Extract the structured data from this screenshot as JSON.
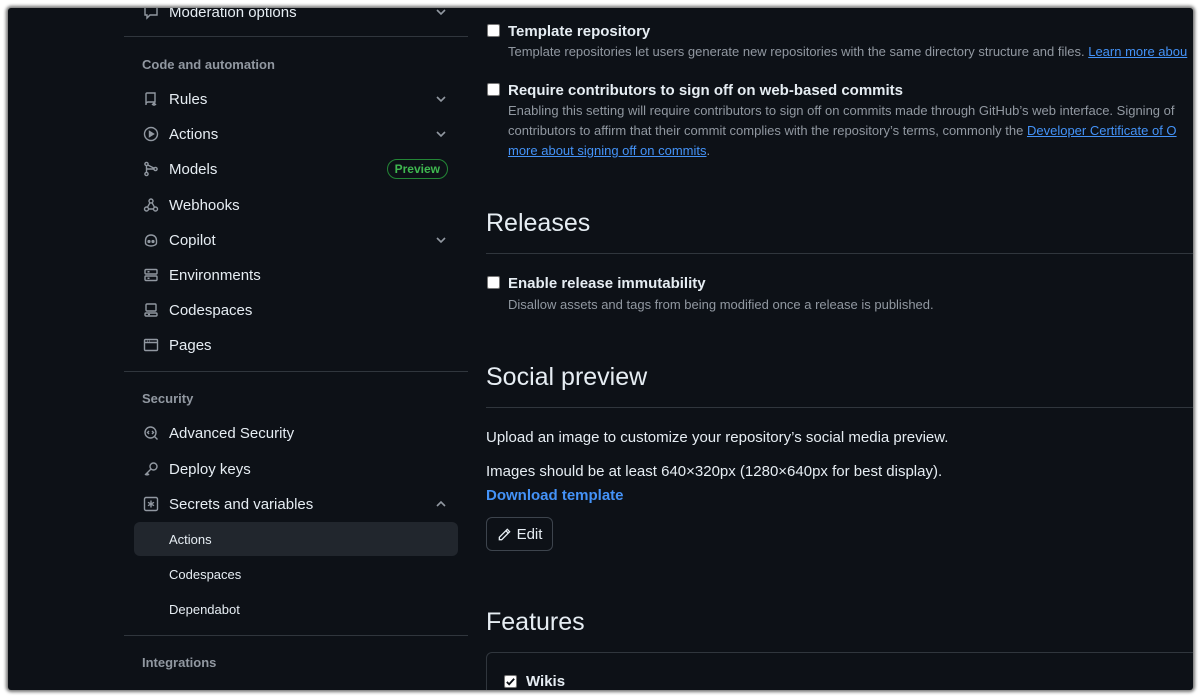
{
  "sidebar": {
    "top_item": {
      "label": "Moderation options",
      "icon": "report-icon"
    },
    "sections": {
      "code_automation": "Code and automation",
      "security": "Security",
      "integrations": "Integrations"
    },
    "code_items": [
      {
        "label": "Rules",
        "icon": "repo-push-icon",
        "expandable": true
      },
      {
        "label": "Actions",
        "icon": "play-icon",
        "expandable": true
      },
      {
        "label": "Models",
        "icon": "models-icon",
        "badge": "Preview"
      },
      {
        "label": "Webhooks",
        "icon": "webhook-icon"
      },
      {
        "label": "Copilot",
        "icon": "copilot-icon",
        "expandable": true
      },
      {
        "label": "Environments",
        "icon": "server-icon"
      },
      {
        "label": "Codespaces",
        "icon": "codespaces-icon"
      },
      {
        "label": "Pages",
        "icon": "browser-icon"
      }
    ],
    "security_items": [
      {
        "label": "Advanced Security",
        "icon": "codescan-icon"
      },
      {
        "label": "Deploy keys",
        "icon": "key-icon"
      },
      {
        "label": "Secrets and variables",
        "icon": "asterisk-icon",
        "expanded": true
      }
    ],
    "secrets_sub": [
      {
        "label": "Actions",
        "active": true
      },
      {
        "label": "Codespaces"
      },
      {
        "label": "Dependabot"
      }
    ]
  },
  "main": {
    "template_repo": {
      "title": "Template repository",
      "desc": "Template repositories let users generate new repositories with the same directory structure and files. ",
      "link": "Learn more abou"
    },
    "signoff": {
      "title": "Require contributors to sign off on web-based commits",
      "line1": "Enabling this setting will require contributors to sign off on commits made through GitHub’s web interface. Signing of",
      "line2_text": "contributors to affirm that their commit complies with the repository’s terms, commonly the ",
      "line2_link": "Developer Certificate of O",
      "line3_link": "more about signing off on commits",
      "line3_end": "."
    },
    "releases": {
      "heading": "Releases",
      "option_title": "Enable release immutability",
      "option_desc": "Disallow assets and tags from being modified once a release is published."
    },
    "social": {
      "heading": "Social preview",
      "line1": "Upload an image to customize your repository’s social media preview.",
      "line2": "Images should be at least 640×320px (1280×640px for best display).",
      "download": "Download template",
      "edit": "Edit"
    },
    "features": {
      "heading": "Features",
      "wikis": "Wikis"
    }
  },
  "colors": {
    "background": "#0d1117",
    "text": "#e6edf3",
    "muted": "#9198a1",
    "border": "#30363d",
    "link": "#4493f8",
    "badge": "#3fb950"
  }
}
